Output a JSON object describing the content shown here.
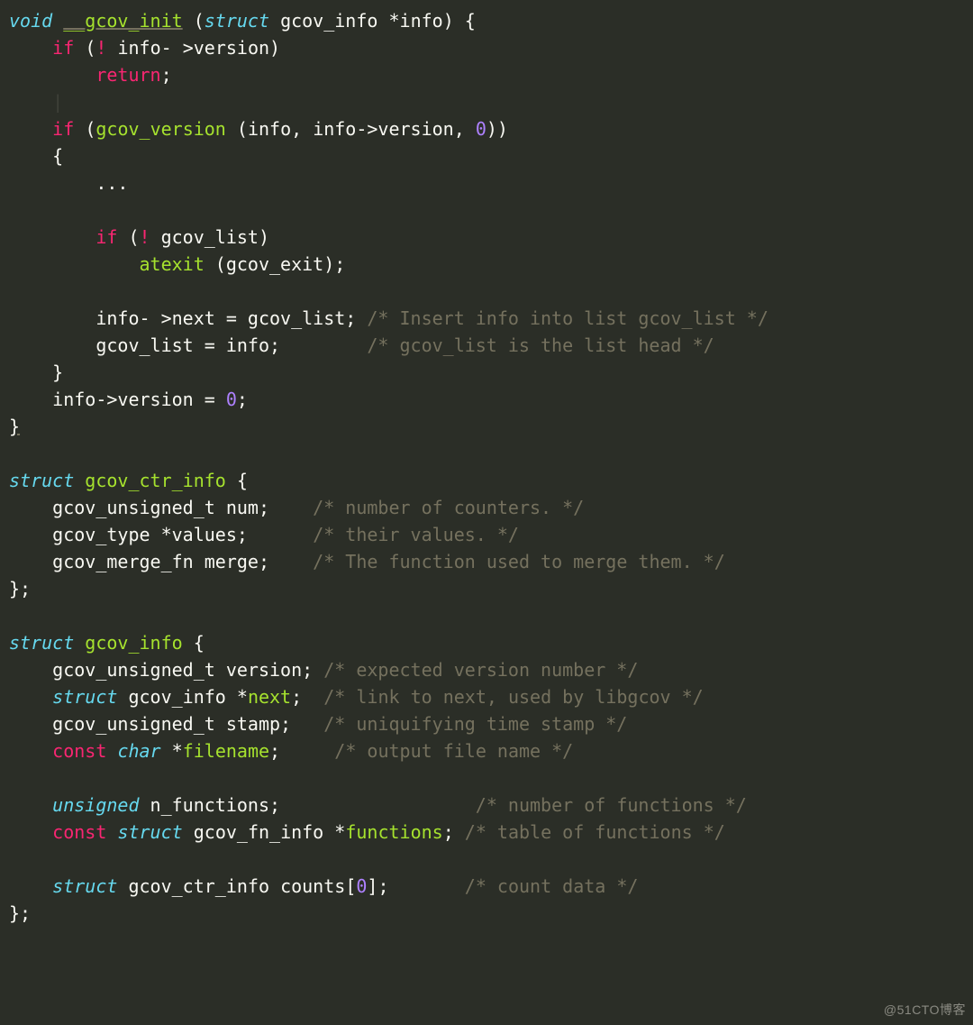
{
  "watermark": "@51CTO博客",
  "code": {
    "l1": {
      "kw_void": "void",
      "fn": "__gcov_init",
      "lp": "(",
      "kw_struct": "struct",
      "type": "gcov_info",
      "arg": "*info",
      "rp_brace": ") {"
    },
    "l2": {
      "kw_if": "if",
      "lp": "(",
      "bang": "!",
      "expr": " info- >version",
      "rp": ")"
    },
    "l3": {
      "kw_return": "return",
      "semi": ";"
    },
    "l4": "",
    "l5": {
      "kw_if": "if",
      "lp": "(",
      "fn": "gcov_version",
      "args": " (info, info->version, ",
      "zero": "0",
      "close": "))"
    },
    "l6": "{",
    "l7": "...",
    "l8": "",
    "l9": {
      "kw_if": "if",
      "lp": "(",
      "bang": "!",
      "expr": " gcov_list",
      "rp": ")"
    },
    "l10": {
      "fn": "atexit",
      "args": " (gcov_exit);"
    },
    "l11": "",
    "l12": {
      "stmt": "info- >next = gcov_list;",
      "comment": "/* Insert info into list gcov_list */"
    },
    "l13": {
      "stmt": "gcov_list = info;",
      "comment": "/* gcov_list is the list head */"
    },
    "l14": "}",
    "l15": {
      "stmt": "info->version = ",
      "zero": "0",
      "semi": ";"
    },
    "l16": "}",
    "l17": "",
    "l18": {
      "kw_struct": "struct",
      "name": "gcov_ctr_info",
      "brace": "{"
    },
    "l19": {
      "decl": "gcov_unsigned_t num;",
      "comment": "/* number of counters. */"
    },
    "l20": {
      "decl_pre": "gcov_type ",
      "star": "*",
      "decl_post": "values;",
      "comment": "/* their values. */"
    },
    "l21": {
      "decl": "gcov_merge_fn merge;",
      "comment": "/* The function used to merge them. */"
    },
    "l22": "};",
    "l23": "",
    "l24": {
      "kw_struct": "struct",
      "name": "gcov_info",
      "brace": "{"
    },
    "l25": {
      "decl": "gcov_unsigned_t version;",
      "comment": "/* expected version number */"
    },
    "l26": {
      "kw_struct": "struct",
      "type": "gcov_info",
      "star": "*",
      "field": "next",
      "semi": ";",
      "comment": "/* link to next, used by libgcov */"
    },
    "l27": {
      "decl": "gcov_unsigned_t stamp;",
      "comment": "/* uniquifying time stamp */"
    },
    "l28": {
      "kw_const": "const",
      "kw_char": "char",
      "star": "*",
      "field": "filename",
      "semi": ";",
      "comment": "/* output file name */"
    },
    "l29": "",
    "l30": {
      "kw_unsigned": "unsigned",
      "field": "n_functions;",
      "comment": "/* number of functions */"
    },
    "l31": {
      "kw_const": "const",
      "kw_struct": "struct",
      "type": "gcov_fn_info",
      "star": "*",
      "field": "functions",
      "semi": ";",
      "comment": "/* table of functions */"
    },
    "l32": "",
    "l33": {
      "kw_struct": "struct",
      "type": "gcov_ctr_info",
      "field": "counts",
      "idx_open": "[",
      "zero": "0",
      "idx_close": "]",
      "semi": ";",
      "comment": "/* count data */"
    },
    "l34": "};"
  }
}
